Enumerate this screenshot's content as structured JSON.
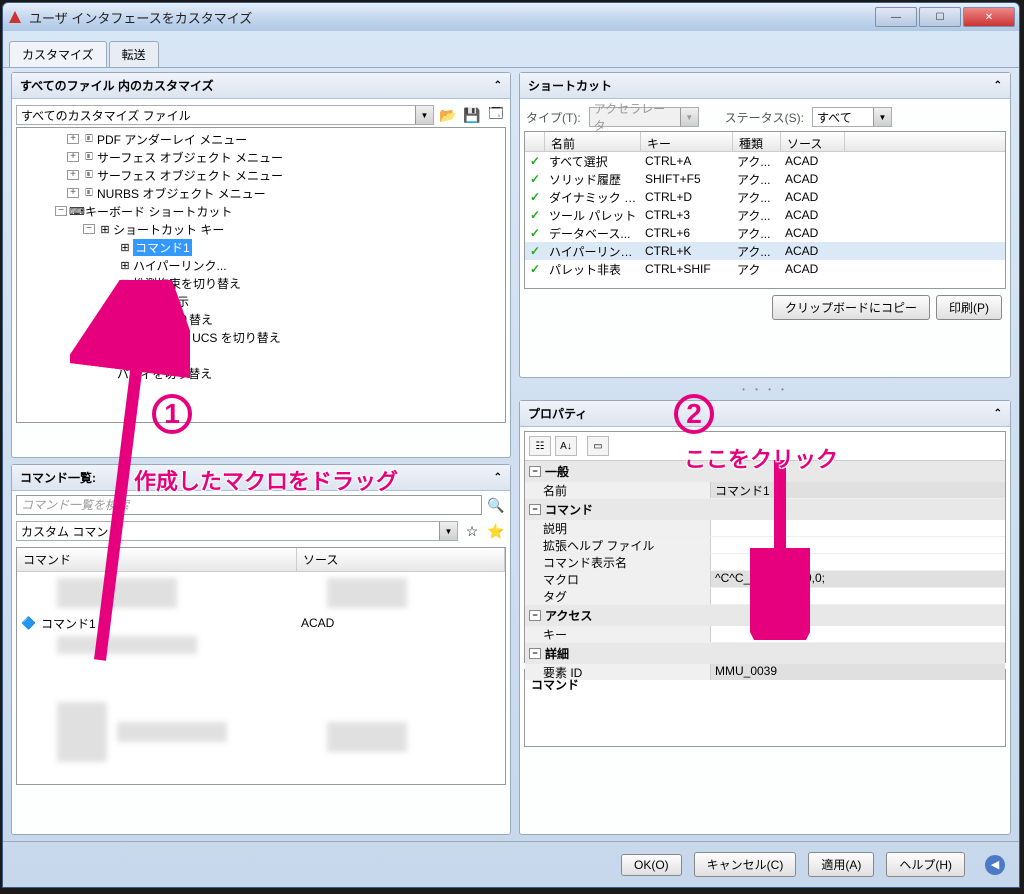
{
  "window": {
    "title": "ユーザ インタフェースをカスタマイズ"
  },
  "tabs": {
    "customize": "カスタマイズ",
    "transfer": "転送"
  },
  "leftTop": {
    "header": "すべてのファイル 内のカスタマイズ",
    "combo": "すべてのカスタマイズ ファイル",
    "tree": [
      "PDF アンダーレイ メニュー",
      "サーフェス オブジェクト メニュー",
      "サーフェス オブジェクト メニュー",
      "NURBS オブジェクト メニュー",
      "キーボード ショートカット",
      "ショートカット キー",
      "コマンド1",
      "ハイパーリンク...",
      "推測拘束を切り替え",
      "レット非表示",
      "座標表示切り替え",
      "ダイナミック UCS を切り替え",
      "切り替え",
      "パティを切り替え"
    ]
  },
  "cmdList": {
    "header": "コマンド一覧:",
    "searchPlaceholder": "コマンド一覧を検索",
    "filterCombo": "カスタム コマンド",
    "cols": {
      "cmd": "コマンド",
      "src": "ソース"
    },
    "row": {
      "name": "コマンド1",
      "src": "ACAD"
    }
  },
  "shortcut": {
    "header": "ショートカット",
    "typeLabel": "タイプ(T):",
    "typeCombo": "アクセラレータ",
    "statusLabel": "ステータス(S):",
    "statusCombo": "すべて",
    "cols": {
      "name": "名前",
      "key": "キー",
      "type": "種類",
      "src": "ソース"
    },
    "rows": [
      {
        "name": "すべて選択",
        "key": "CTRL+A",
        "type": "アク...",
        "src": "ACAD"
      },
      {
        "name": "ソリッド履歴",
        "key": "SHIFT+F5",
        "type": "アク...",
        "src": "ACAD"
      },
      {
        "name": "ダイナミック U...",
        "key": "CTRL+D",
        "type": "アク...",
        "src": "ACAD"
      },
      {
        "name": "ツール パレット",
        "key": "CTRL+3",
        "type": "アク...",
        "src": "ACAD"
      },
      {
        "name": "データベース...",
        "key": "CTRL+6",
        "type": "アク...",
        "src": "ACAD"
      },
      {
        "name": "ハイパーリンク...",
        "key": "CTRL+K",
        "type": "アク...",
        "src": "ACAD"
      },
      {
        "name": "パレット非表",
        "key": "CTRL+SHIF",
        "type": "アク",
        "src": "ACAD"
      }
    ],
    "copyBtn": "クリップボードにコピー",
    "printBtn": "印刷(P)"
  },
  "props": {
    "header": "プロパティ",
    "cats": {
      "general": "一般",
      "command": "コマンド",
      "access": "アクセス",
      "detail": "詳細"
    },
    "rows": {
      "name": {
        "k": "名前",
        "v": "コマンド1"
      },
      "desc": {
        "k": "説明",
        "v": ""
      },
      "exthelp": {
        "k": "拡張ヘルプ ファイル",
        "v": ""
      },
      "dispname": {
        "k": "コマンド表示名",
        "v": ""
      },
      "macro": {
        "k": "マクロ",
        "v": "^C^C_circle;non;0,0;"
      },
      "tag": {
        "k": "タグ",
        "v": ""
      },
      "key": {
        "k": "キー",
        "v": ""
      },
      "eid": {
        "k": "要素 ID",
        "v": "MMU_0039"
      }
    },
    "descTitle": "コマンド"
  },
  "footer": {
    "ok": "OK(O)",
    "cancel": "キャンセル(C)",
    "apply": "適用(A)",
    "help": "ヘルプ(H)"
  },
  "anno": {
    "text1": "作成したマクロをドラッグ",
    "text2": "ここをクリック"
  }
}
